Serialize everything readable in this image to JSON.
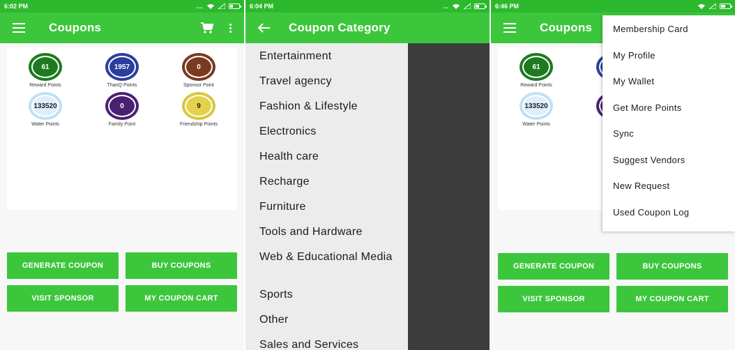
{
  "screen1": {
    "status_time": "6:02 PM",
    "status_dots": "....",
    "title": "Coupons",
    "points": [
      {
        "value": "61",
        "label": "Reward Points",
        "color": "#1e7a1e",
        "fill": "#1e7a1e",
        "text": "#ffffff"
      },
      {
        "value": "1957",
        "label": "ThanQ Points",
        "color": "#2a3f9d",
        "fill": "#2a3f9d",
        "text": "#ffffff"
      },
      {
        "value": "0",
        "label": "Sponsor Point",
        "color": "#7a3a22",
        "fill": "#7a3a22",
        "text": "#ffffff"
      },
      {
        "value": "133520",
        "label": "Water Points",
        "color": "#bfe0f5",
        "fill": "#dceffb",
        "text": "#222222"
      },
      {
        "value": "0",
        "label": "Family Point",
        "color": "#4a2170",
        "fill": "#4a2170",
        "text": "#ffffff"
      },
      {
        "value": "9",
        "label": "Friendship Points",
        "color": "#d9c63a",
        "fill": "#e3d24a",
        "text": "#222222"
      }
    ],
    "buttons": {
      "generate": "GENERATE COUPON",
      "buy": "BUY COUPONS",
      "visit": "VISIT SPONSOR",
      "cart": "MY COUPON CART"
    }
  },
  "screen2": {
    "status_time": "6:04 PM",
    "status_dots": "...",
    "title": "Coupon Category",
    "categories": [
      "Entertainment",
      "Travel agency",
      "Fashion & Lifestyle",
      "Electronics",
      "Health care",
      "Recharge",
      "Furniture",
      "Tools and Hardware",
      "Web & Educational Media",
      "Sports",
      "Other",
      "Sales and Services"
    ]
  },
  "screen3": {
    "status_time": "6:46 PM",
    "title": "Coupons",
    "menu_items": [
      "Membership Card",
      "My Profile",
      "My Wallet",
      "Get More Points",
      "Sync",
      "Suggest Vendors",
      "New Request",
      "Used Coupon Log"
    ],
    "points": [
      {
        "value": "61",
        "label": "Reward Points",
        "color": "#1e7a1e",
        "fill": "#1e7a1e",
        "text": "#ffffff"
      },
      {
        "value": "",
        "label": "Th",
        "color": "#2a3f9d",
        "fill": "#2a3f9d",
        "text": "#ffffff"
      },
      {
        "value": "133520",
        "label": "Water Points",
        "color": "#bfe0f5",
        "fill": "#dceffb",
        "text": "#222222"
      },
      {
        "value": "",
        "label": "F",
        "color": "#4a2170",
        "fill": "#4a2170",
        "text": "#ffffff"
      }
    ],
    "buttons": {
      "generate": "GENERATE COUPON",
      "buy": "BUY COUPONS",
      "visit": "VISIT SPONSOR",
      "cart": "MY COUPON CART"
    }
  },
  "colors": {
    "primary": "#3cc63c",
    "status_bar": "#2db92d"
  }
}
